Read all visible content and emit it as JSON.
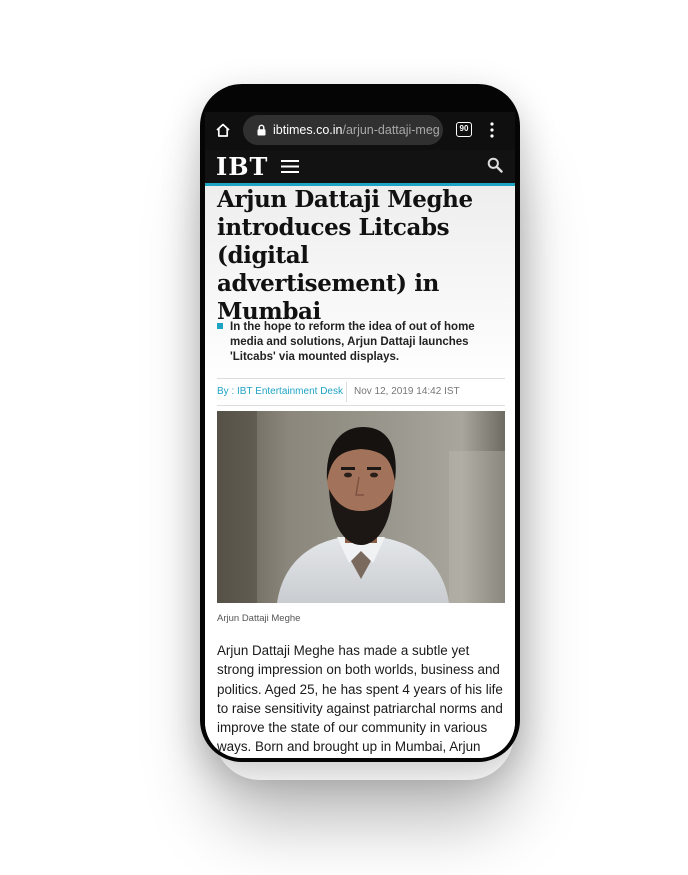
{
  "browser": {
    "url_domain": "ibtimes.co.in",
    "url_path": "/arjun-dattaji-meg",
    "tab_count": "90",
    "icons": [
      "home-icon",
      "lock-icon",
      "tabs-icon",
      "more-vert-icon"
    ]
  },
  "site": {
    "logo": "IBT",
    "accent_color": "#1fa3c4",
    "icons": [
      "hamburger-menu-icon",
      "search-icon"
    ]
  },
  "article": {
    "headline": "Arjun Dattaji Meghe introduces Litcabs (digital advertisement) in Mumbai",
    "summary": "In the hope to reform the idea of out of home media and solutions, Arjun Dattaji launches 'Litcabs' via mounted displays.",
    "author": "By : IBT Entertainment Desk",
    "date": "Nov 12, 2019 14:42 IST",
    "image_caption": "Arjun Dattaji Meghe",
    "body": "Arjun Dattaji Meghe has made a subtle yet strong impression on both worlds, business and politics. Aged 25, he has spent 4 years of his life to raise sensitivity against patriarchal norms and improve the state of our community in various ways. Born and brought up in Mumbai, Arjun"
  }
}
